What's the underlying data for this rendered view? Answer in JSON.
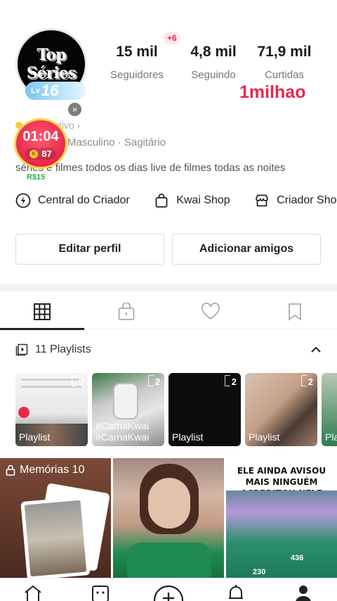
{
  "profile": {
    "avatar_line1": "Top",
    "avatar_line2": "Séries",
    "level_prefix": "Lv",
    "level": "16",
    "close": "×",
    "plus_badge": "+6",
    "stats": [
      {
        "value": "15 mil",
        "label": "Seguidores"
      },
      {
        "value": "4,8 mil",
        "label": "Seguindo"
      },
      {
        "value": "71,9 mil",
        "label": "Curtidas"
      }
    ],
    "milestone": "1milhao",
    "status_text": "tivo ›",
    "gender_sign": "Masculino · Sagitário",
    "bio": "séries e filmes todos os dias live de filmes todas as noites",
    "money": "R$15"
  },
  "live_timer": {
    "time": "01:04",
    "coin_icon": "K",
    "coins": "87"
  },
  "links": [
    {
      "label": "Central do Criador",
      "icon": "lightning-circle-icon"
    },
    {
      "label": "Kwai Shop",
      "icon": "shopping-bag-icon"
    },
    {
      "label": "Criador Shop",
      "icon": "store-icon"
    }
  ],
  "buttons": {
    "edit": "Editar perfil",
    "add_friends": "Adicionar amigos"
  },
  "tabs": [
    "grid-icon",
    "lock-bag-icon",
    "heart-icon",
    "bookmark-icon"
  ],
  "playlists": {
    "header": "11 Playlists",
    "items": [
      {
        "name": "Playlist",
        "count": "2"
      },
      {
        "name": "#CarnaKwai #CarnaKwai",
        "count": "2"
      },
      {
        "name": "Playlist",
        "count": "2"
      },
      {
        "name": "Playlist",
        "count": "2"
      },
      {
        "name": "Pla",
        "count": ""
      }
    ]
  },
  "videos": {
    "memories_label": "Memórias 10",
    "caption": "ELE AINDA AVISOU MAIS NINGUÉM ACREDITOU NELE",
    "tag_a": "230",
    "tag_b": "436"
  },
  "colors": {
    "accent": "#e8284c",
    "money": "#27b44a",
    "level_badge": "#7ac6ef"
  },
  "bottom_nav": [
    "home-icon",
    "inbox-icon",
    "create-icon",
    "notifications-icon",
    "profile-icon"
  ]
}
